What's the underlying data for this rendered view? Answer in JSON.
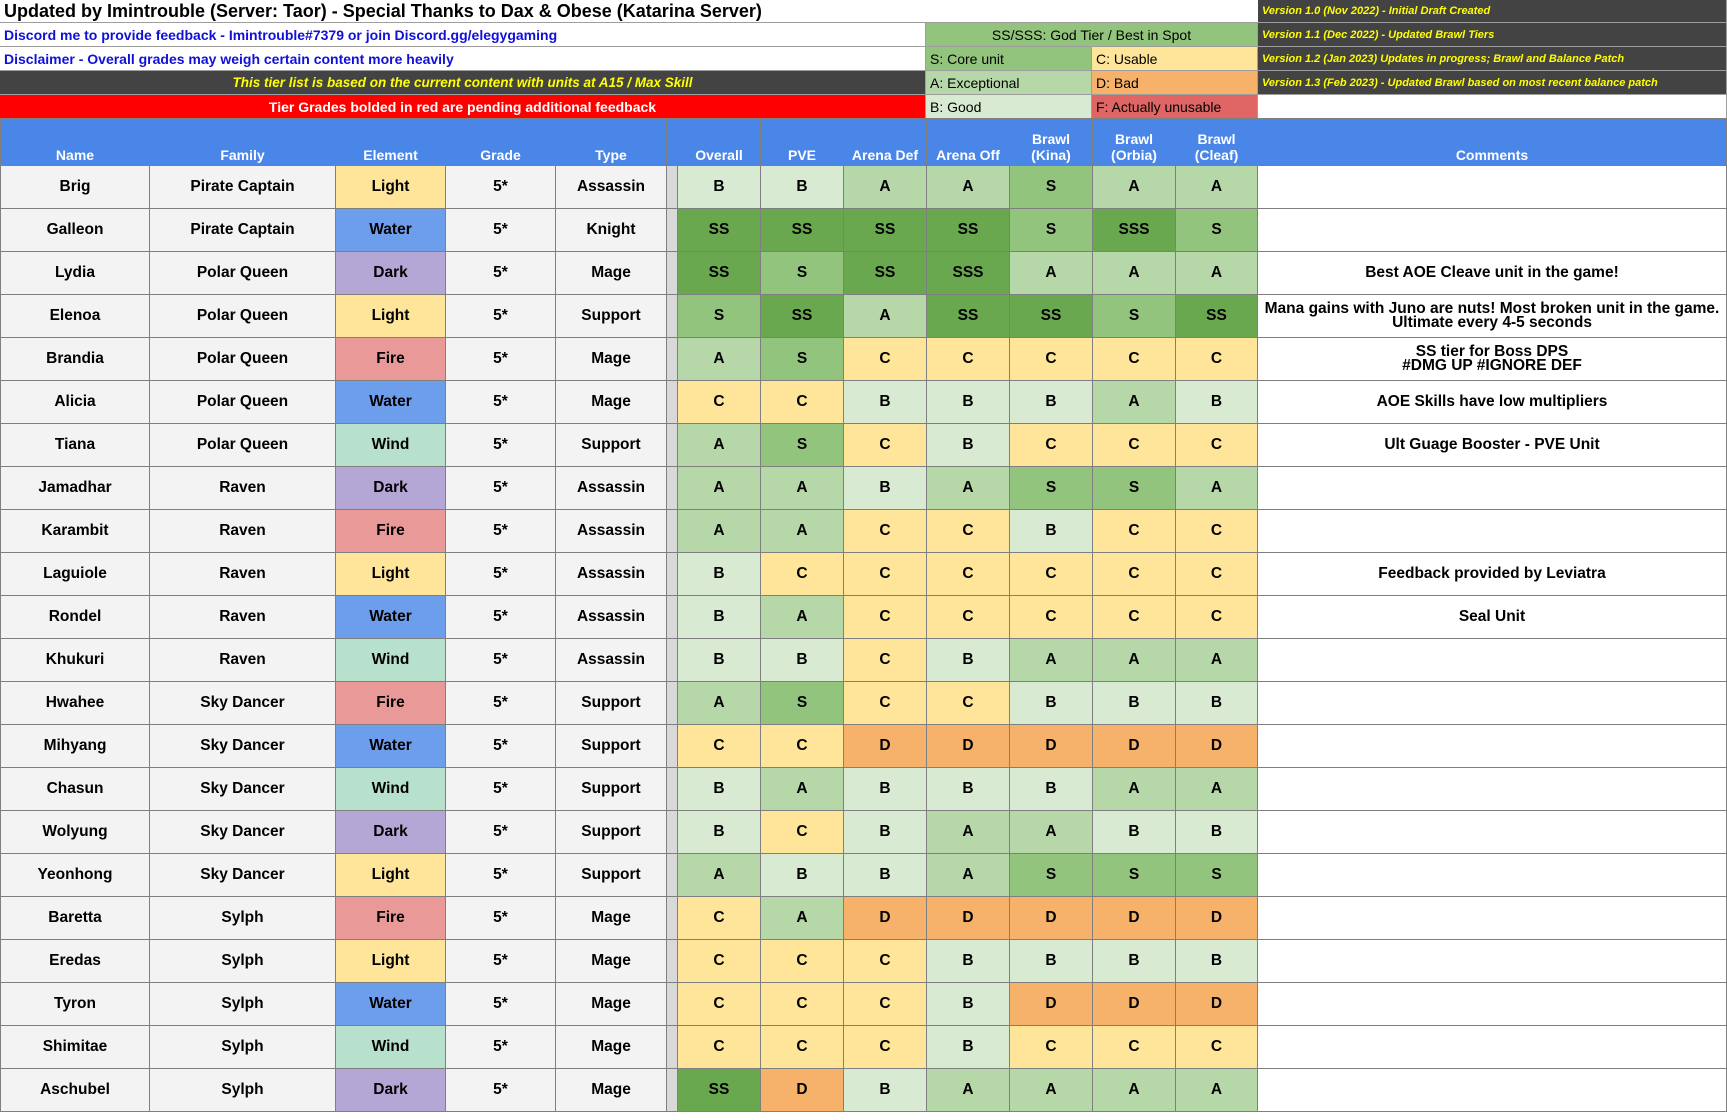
{
  "title": "Updated by Imintrouble (Server: Taor) - Special Thanks to Dax & Obese (Katarina Server)",
  "feedback_line": "Discord me to provide feedback - Imintrouble#7379 or join Discord.gg/elegygaming",
  "disclaimer": "Disclaimer - Overall grades may weigh certain content more heavily",
  "content_note": "This tier list is based on the current content with units at A15 / Max Skill",
  "red_note": "Tier Grades bolded in red are pending additional feedback",
  "legend": {
    "god": "SS/SSS: God Tier / Best in Spot",
    "s": "S: Core unit",
    "c": "C: Usable",
    "a": "A: Exceptional",
    "d": "D: Bad",
    "b": "B: Good",
    "f": "F: Actually unusable"
  },
  "versions": [
    "Version 1.0 (Nov 2022) - Initial Draft Created",
    "Version 1.1 (Dec 2022) - Updated Brawl Tiers",
    "Version 1.2 (Jan 2023) Updates in progress; Brawl and Balance Patch",
    "Version 1.3 (Feb 2023) - Updated Brawl based on most recent balance patch"
  ],
  "columns": {
    "name": "Name",
    "family": "Family",
    "element": "Element",
    "grade": "Grade",
    "type": "Type",
    "overall": "Overall",
    "pve": "PVE",
    "arena_def": "Arena Def",
    "arena_off": "Arena Off",
    "brawl_kina_1": "Brawl",
    "brawl_kina_2": "(Kina)",
    "brawl_orbia_1": "Brawl",
    "brawl_orbia_2": "(Orbia)",
    "brawl_cleaf_1": "Brawl",
    "brawl_cleaf_2": "(Cleaf)",
    "comments": "Comments"
  },
  "colors": {
    "header_blue": "#4a86e8",
    "tier_SS": "#6aa84f",
    "tier_S": "#93c47d",
    "tier_A": "#b6d7a8",
    "tier_B": "#d9ead3",
    "tier_C": "#ffe599",
    "tier_D": "#f6b26b",
    "tier_F": "#e06666"
  },
  "rows": [
    {
      "name": "Brig",
      "family": "Pirate Captain",
      "element": "Light",
      "grade": "5*",
      "type": "Assassin",
      "tiers": [
        "B",
        "B",
        "A",
        "A",
        "S",
        "A",
        "A"
      ],
      "comment": ""
    },
    {
      "name": "Galleon",
      "family": "Pirate Captain",
      "element": "Water",
      "grade": "5*",
      "type": "Knight",
      "tiers": [
        "SS",
        "SS",
        "SS",
        "SS",
        "S",
        "SSS",
        "S"
      ],
      "comment": ""
    },
    {
      "name": "Lydia",
      "family": "Polar Queen",
      "element": "Dark",
      "grade": "5*",
      "type": "Mage",
      "tiers": [
        "SS",
        "S",
        "SS",
        "SSS",
        "A",
        "A",
        "A"
      ],
      "comment": "Best AOE Cleave unit in the game!"
    },
    {
      "name": "Elenoa",
      "family": "Polar Queen",
      "element": "Light",
      "grade": "5*",
      "type": "Support",
      "tiers": [
        "S",
        "SS",
        "A",
        "SS",
        "SS",
        "S",
        "SS"
      ],
      "comment": "Mana gains with Juno are nuts! Most broken unit in the game. Ultimate every 4-5 seconds"
    },
    {
      "name": "Brandia",
      "family": "Polar Queen",
      "element": "Fire",
      "grade": "5*",
      "type": "Mage",
      "tiers": [
        "A",
        "S",
        "C",
        "C",
        "C",
        "C",
        "C"
      ],
      "comment": "SS tier for Boss DPS\n#DMG UP #IGNORE DEF"
    },
    {
      "name": "Alicia",
      "family": "Polar Queen",
      "element": "Water",
      "grade": "5*",
      "type": "Mage",
      "tiers": [
        "C",
        "C",
        "B",
        "B",
        "B",
        "A",
        "B"
      ],
      "comment": "AOE Skills have low multipliers"
    },
    {
      "name": "Tiana",
      "family": "Polar Queen",
      "element": "Wind",
      "grade": "5*",
      "type": "Support",
      "tiers": [
        "A",
        "S",
        "C",
        "B",
        "C",
        "C",
        "C"
      ],
      "comment": "Ult Guage Booster - PVE Unit"
    },
    {
      "name": "Jamadhar",
      "family": "Raven",
      "element": "Dark",
      "grade": "5*",
      "type": "Assassin",
      "tiers": [
        "A",
        "A",
        "B",
        "A",
        "S",
        "S",
        "A"
      ],
      "comment": ""
    },
    {
      "name": "Karambit",
      "family": "Raven",
      "element": "Fire",
      "grade": "5*",
      "type": "Assassin",
      "tiers": [
        "A",
        "A",
        "C",
        "C",
        "B",
        "C",
        "C"
      ],
      "comment": ""
    },
    {
      "name": "Laguiole",
      "family": "Raven",
      "element": "Light",
      "grade": "5*",
      "type": "Assassin",
      "tiers": [
        "B",
        "C",
        "C",
        "C",
        "C",
        "C",
        "C"
      ],
      "comment": "Feedback provided by Leviatra"
    },
    {
      "name": "Rondel",
      "family": "Raven",
      "element": "Water",
      "grade": "5*",
      "type": "Assassin",
      "tiers": [
        "B",
        "A",
        "C",
        "C",
        "C",
        "C",
        "C"
      ],
      "comment": "Seal Unit"
    },
    {
      "name": "Khukuri",
      "family": "Raven",
      "element": "Wind",
      "grade": "5*",
      "type": "Assassin",
      "tiers": [
        "B",
        "B",
        "C",
        "B",
        "A",
        "A",
        "A"
      ],
      "comment": ""
    },
    {
      "name": "Hwahee",
      "family": "Sky Dancer",
      "element": "Fire",
      "grade": "5*",
      "type": "Support",
      "tiers": [
        "A",
        "S",
        "C",
        "C",
        "B",
        "B",
        "B"
      ],
      "comment": ""
    },
    {
      "name": "Mihyang",
      "family": "Sky Dancer",
      "element": "Water",
      "grade": "5*",
      "type": "Support",
      "tiers": [
        "C",
        "C",
        "D",
        "D",
        "D",
        "D",
        "D"
      ],
      "comment": ""
    },
    {
      "name": "Chasun",
      "family": "Sky Dancer",
      "element": "Wind",
      "grade": "5*",
      "type": "Support",
      "tiers": [
        "B",
        "A",
        "B",
        "B",
        "B",
        "A",
        "A"
      ],
      "comment": ""
    },
    {
      "name": "Wolyung",
      "family": "Sky Dancer",
      "element": "Dark",
      "grade": "5*",
      "type": "Support",
      "tiers": [
        "B",
        "C",
        "B",
        "A",
        "A",
        "B",
        "B"
      ],
      "comment": ""
    },
    {
      "name": "Yeonhong",
      "family": "Sky Dancer",
      "element": "Light",
      "grade": "5*",
      "type": "Support",
      "tiers": [
        "A",
        "B",
        "B",
        "A",
        "S",
        "S",
        "S"
      ],
      "comment": ""
    },
    {
      "name": "Baretta",
      "family": "Sylph",
      "element": "Fire",
      "grade": "5*",
      "type": "Mage",
      "tiers": [
        "C",
        "A",
        "D",
        "D",
        "D",
        "D",
        "D"
      ],
      "comment": ""
    },
    {
      "name": "Eredas",
      "family": "Sylph",
      "element": "Light",
      "grade": "5*",
      "type": "Mage",
      "tiers": [
        "C",
        "C",
        "C",
        "B",
        "B",
        "B",
        "B"
      ],
      "comment": ""
    },
    {
      "name": "Tyron",
      "family": "Sylph",
      "element": "Water",
      "grade": "5*",
      "type": "Mage",
      "tiers": [
        "C",
        "C",
        "C",
        "B",
        "D",
        "D",
        "D"
      ],
      "comment": ""
    },
    {
      "name": "Shimitae",
      "family": "Sylph",
      "element": "Wind",
      "grade": "5*",
      "type": "Mage",
      "tiers": [
        "C",
        "C",
        "C",
        "B",
        "C",
        "C",
        "C"
      ],
      "comment": ""
    },
    {
      "name": "Aschubel",
      "family": "Sylph",
      "element": "Dark",
      "grade": "5*",
      "type": "Mage",
      "tiers": [
        "SS",
        "D",
        "B",
        "A",
        "A",
        "A",
        "A"
      ],
      "comment": ""
    }
  ]
}
